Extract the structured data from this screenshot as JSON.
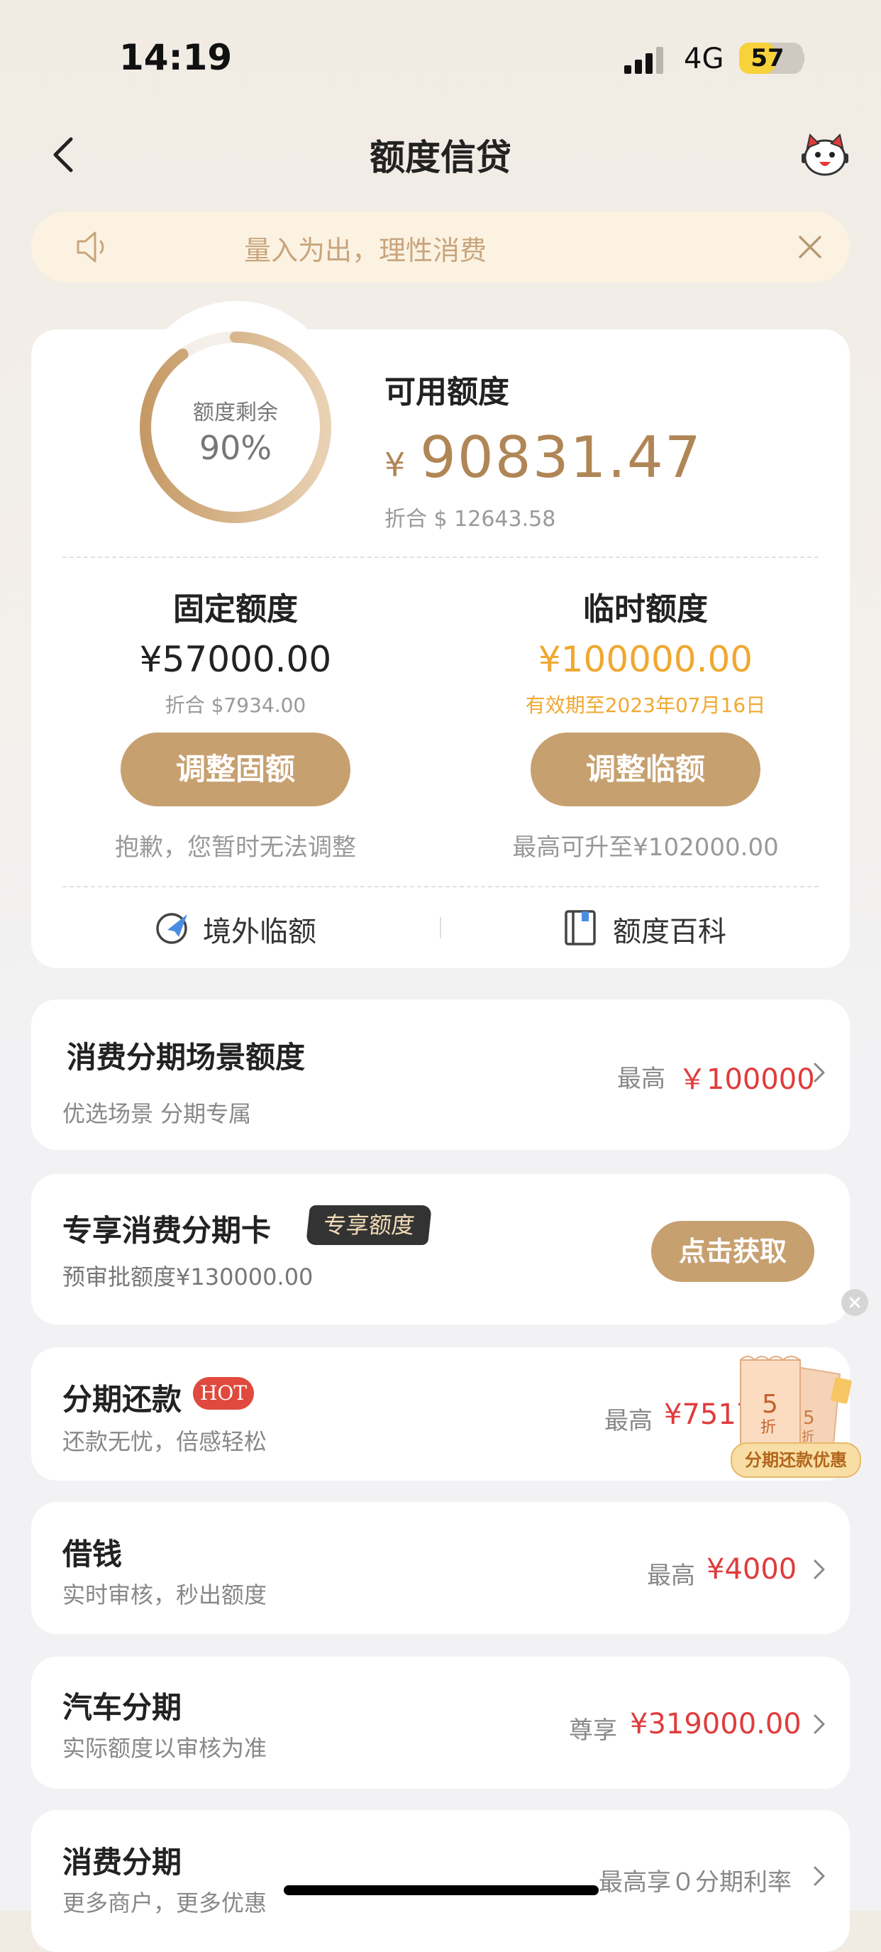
{
  "status_bar": {
    "time": "14:19",
    "network": "4G",
    "battery": "57",
    "battery_level": 0.57
  },
  "header": {
    "title": "额度信贷"
  },
  "notice": {
    "text": "量入为出，理性消费"
  },
  "credit": {
    "ring_label": "额度剩余",
    "ring_percent": "90%",
    "ring_fraction": 0.9,
    "available_label": "可用额度",
    "available_currency": "¥",
    "available_amount": "90831.47",
    "available_converted": "折合 $ 12643.58",
    "fixed": {
      "title": "固定额度",
      "amount": "¥57000.00",
      "sub": "折合 $7934.00",
      "button": "调整固额",
      "note": "抱歉，您暂时无法调整"
    },
    "temporary": {
      "title": "临时额度",
      "amount": "¥100000.00",
      "sub": "有效期至2023年07月16日",
      "button": "调整临额",
      "note": "最高可升至¥102000.00"
    },
    "links": [
      {
        "label": "境外临额",
        "icon": "plane-globe-icon"
      },
      {
        "label": "额度百科",
        "icon": "book-icon"
      }
    ]
  },
  "rows": {
    "scene": {
      "title": "消费分期场景额度",
      "sub": "优选场景 分期专属",
      "prefix": "最高",
      "amount": "￥100000"
    },
    "card": {
      "title": "专享消费分期卡",
      "tag": "专享额度",
      "sub": "预审批额度¥130000.00",
      "button": "点击获取"
    },
    "repay": {
      "title": "分期还款",
      "badge": "HOT",
      "sub": "还款无忧，倍感轻松",
      "prefix": "最高",
      "amount": "¥7517",
      "promo_label": "分期还款优惠",
      "promo_digit": "5",
      "promo_unit": "折"
    },
    "borrow": {
      "title": "借钱",
      "sub": "实时审核，秒出额度",
      "prefix": "最高",
      "amount": "¥4000"
    },
    "car": {
      "title": "汽车分期",
      "sub": "实际额度以审核为准",
      "prefix": "尊享",
      "amount": "¥319000.00"
    },
    "consume": {
      "title": "消费分期",
      "sub": "更多商户，更多优惠",
      "note": "最高享０分期利率"
    }
  },
  "colors": {
    "gold": "#c7a070",
    "gold_text": "#b08656",
    "orange": "#f0a830",
    "red": "#e03c3c"
  }
}
